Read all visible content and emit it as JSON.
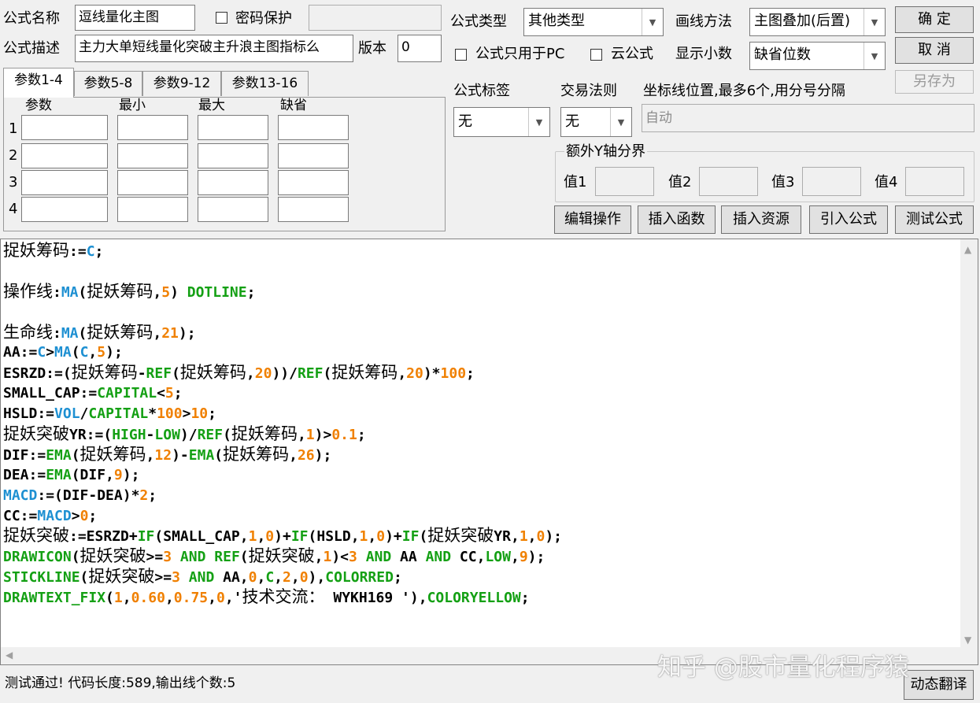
{
  "formula": {
    "name_label": "公式名称",
    "name_value": "逗线量化主图",
    "password_label": "密码保护",
    "desc_label": "公式描述",
    "desc_value": "主力大单短线量化突破主升浪主图指标么",
    "version_label": "版本",
    "version_value": "0",
    "type_label": "公式类型",
    "type_value": "其他类型",
    "draw_label": "画线方法",
    "draw_value": "主图叠加(后置)",
    "pc_only_label": "公式只用于PC",
    "cloud_label": "云公式",
    "decimal_label": "显示小数",
    "decimal_value": "缺省位数",
    "tag_label": "公式标签",
    "tag_value": "无",
    "rule_label": "交易法则",
    "rule_value": "无",
    "coord_label": "坐标线位置,最多6个,用分号分隔",
    "coord_placeholder": "自动",
    "yaxis_label": "额外Y轴分界",
    "y_values": [
      "值1",
      "值2",
      "值3",
      "值4"
    ]
  },
  "buttons": {
    "ok": "确  定",
    "cancel": "取  消",
    "save_as": "另存为",
    "edit": "编辑操作",
    "insert_func": "插入函数",
    "insert_res": "插入资源",
    "import": "引入公式",
    "test": "测试公式",
    "translate": "动态翻译"
  },
  "param_tabs": [
    "参数1-4",
    "参数5-8",
    "参数9-12",
    "参数13-16"
  ],
  "param_headers": [
    "参数",
    "最小",
    "最大",
    "缺省"
  ],
  "param_rows": [
    "1",
    "2",
    "3",
    "4"
  ],
  "code_lines": [
    [
      [
        "t",
        "捉妖筹码"
      ],
      [
        "p",
        ":="
      ],
      [
        "b",
        "C"
      ],
      [
        "p",
        ";"
      ]
    ],
    [],
    [
      [
        "t",
        "操作线"
      ],
      [
        "p",
        ":"
      ],
      [
        "b",
        "MA"
      ],
      [
        "p",
        "("
      ],
      [
        "t",
        "捉妖筹码"
      ],
      [
        "p",
        ","
      ],
      [
        "n",
        "5"
      ],
      [
        "p",
        ") "
      ],
      [
        "g",
        "DOTLINE"
      ],
      [
        "p",
        ";"
      ]
    ],
    [],
    [
      [
        "t",
        "生命线"
      ],
      [
        "p",
        ":"
      ],
      [
        "b",
        "MA"
      ],
      [
        "p",
        "("
      ],
      [
        "t",
        "捉妖筹码"
      ],
      [
        "p",
        ","
      ],
      [
        "n",
        "21"
      ],
      [
        "p",
        ");"
      ]
    ],
    [
      [
        "p",
        "AA:="
      ],
      [
        "b",
        "C"
      ],
      [
        "p",
        ">"
      ],
      [
        "b",
        "MA"
      ],
      [
        "p",
        "("
      ],
      [
        "b",
        "C"
      ],
      [
        "p",
        ","
      ],
      [
        "n",
        "5"
      ],
      [
        "p",
        ");"
      ]
    ],
    [
      [
        "p",
        "ESRZD:=("
      ],
      [
        "t",
        "捉妖筹码"
      ],
      [
        "p",
        "-"
      ],
      [
        "g",
        "REF"
      ],
      [
        "p",
        "("
      ],
      [
        "t",
        "捉妖筹码"
      ],
      [
        "p",
        ","
      ],
      [
        "n",
        "20"
      ],
      [
        "p",
        "))/"
      ],
      [
        "g",
        "REF"
      ],
      [
        "p",
        "("
      ],
      [
        "t",
        "捉妖筹码"
      ],
      [
        "p",
        ","
      ],
      [
        "n",
        "20"
      ],
      [
        "p",
        ")*"
      ],
      [
        "n",
        "100"
      ],
      [
        "p",
        ";"
      ]
    ],
    [
      [
        "p",
        "SMALL_CAP:="
      ],
      [
        "g",
        "CAPITAL"
      ],
      [
        "p",
        "<"
      ],
      [
        "n",
        "5"
      ],
      [
        "p",
        ";"
      ]
    ],
    [
      [
        "p",
        "HSLD:="
      ],
      [
        "b",
        "VOL"
      ],
      [
        "p",
        "/"
      ],
      [
        "g",
        "CAPITAL"
      ],
      [
        "p",
        "*"
      ],
      [
        "n",
        "100"
      ],
      [
        "p",
        ">"
      ],
      [
        "n",
        "10"
      ],
      [
        "p",
        ";"
      ]
    ],
    [
      [
        "t",
        "捉妖突破"
      ],
      [
        "p",
        "YR:=("
      ],
      [
        "g",
        "HIGH"
      ],
      [
        "p",
        "-"
      ],
      [
        "g",
        "LOW"
      ],
      [
        "p",
        ")/"
      ],
      [
        "g",
        "REF"
      ],
      [
        "p",
        "("
      ],
      [
        "t",
        "捉妖筹码"
      ],
      [
        "p",
        ","
      ],
      [
        "n",
        "1"
      ],
      [
        "p",
        ")>"
      ],
      [
        "n",
        "0.1"
      ],
      [
        "p",
        ";"
      ]
    ],
    [
      [
        "p",
        "DIF:="
      ],
      [
        "g",
        "EMA"
      ],
      [
        "p",
        "("
      ],
      [
        "t",
        "捉妖筹码"
      ],
      [
        "p",
        ","
      ],
      [
        "n",
        "12"
      ],
      [
        "p",
        ")-"
      ],
      [
        "g",
        "EMA"
      ],
      [
        "p",
        "("
      ],
      [
        "t",
        "捉妖筹码"
      ],
      [
        "p",
        ","
      ],
      [
        "n",
        "26"
      ],
      [
        "p",
        ");"
      ]
    ],
    [
      [
        "p",
        "DEA:="
      ],
      [
        "g",
        "EMA"
      ],
      [
        "p",
        "(DIF,"
      ],
      [
        "n",
        "9"
      ],
      [
        "p",
        ");"
      ]
    ],
    [
      [
        "b",
        "MACD"
      ],
      [
        "p",
        ":=(DIF-DEA)*"
      ],
      [
        "n",
        "2"
      ],
      [
        "p",
        ";"
      ]
    ],
    [
      [
        "p",
        "CC:="
      ],
      [
        "b",
        "MACD"
      ],
      [
        "p",
        ">"
      ],
      [
        "n",
        "0"
      ],
      [
        "p",
        ";"
      ]
    ],
    [
      [
        "t",
        "捉妖突破"
      ],
      [
        "p",
        ":=ESRZD+"
      ],
      [
        "g",
        "IF"
      ],
      [
        "p",
        "(SMALL_CAP,"
      ],
      [
        "n",
        "1"
      ],
      [
        "p",
        ","
      ],
      [
        "n",
        "0"
      ],
      [
        "p",
        ")+"
      ],
      [
        "g",
        "IF"
      ],
      [
        "p",
        "(HSLD,"
      ],
      [
        "n",
        "1"
      ],
      [
        "p",
        ","
      ],
      [
        "n",
        "0"
      ],
      [
        "p",
        ")+"
      ],
      [
        "g",
        "IF"
      ],
      [
        "p",
        "("
      ],
      [
        "t",
        "捉妖突破"
      ],
      [
        "p",
        "YR,"
      ],
      [
        "n",
        "1"
      ],
      [
        "p",
        ","
      ],
      [
        "n",
        "0"
      ],
      [
        "p",
        ");"
      ]
    ],
    [
      [
        "g",
        "DRAWICON"
      ],
      [
        "p",
        "("
      ],
      [
        "t",
        "捉妖突破"
      ],
      [
        "p",
        ">="
      ],
      [
        "n",
        "3"
      ],
      [
        "p",
        " "
      ],
      [
        "g",
        "AND"
      ],
      [
        "p",
        " "
      ],
      [
        "g",
        "REF"
      ],
      [
        "p",
        "("
      ],
      [
        "t",
        "捉妖突破"
      ],
      [
        "p",
        ","
      ],
      [
        "n",
        "1"
      ],
      [
        "p",
        ")<"
      ],
      [
        "n",
        "3"
      ],
      [
        "p",
        " "
      ],
      [
        "g",
        "AND"
      ],
      [
        "p",
        " AA "
      ],
      [
        "g",
        "AND"
      ],
      [
        "p",
        " CC,"
      ],
      [
        "g",
        "LOW"
      ],
      [
        "p",
        ","
      ],
      [
        "n",
        "9"
      ],
      [
        "p",
        ");"
      ]
    ],
    [
      [
        "g",
        "STICKLINE"
      ],
      [
        "p",
        "("
      ],
      [
        "t",
        "捉妖突破"
      ],
      [
        "p",
        ">="
      ],
      [
        "n",
        "3"
      ],
      [
        "p",
        " "
      ],
      [
        "g",
        "AND"
      ],
      [
        "p",
        " AA,"
      ],
      [
        "n",
        "0"
      ],
      [
        "p",
        ","
      ],
      [
        "g",
        "C"
      ],
      [
        "p",
        ","
      ],
      [
        "n",
        "2"
      ],
      [
        "p",
        ","
      ],
      [
        "n",
        "0"
      ],
      [
        "p",
        "),"
      ],
      [
        "g",
        "COLORRED"
      ],
      [
        "p",
        ";"
      ]
    ],
    [
      [
        "g",
        "DRAWTEXT_FIX"
      ],
      [
        "p",
        "("
      ],
      [
        "n",
        "1"
      ],
      [
        "p",
        ","
      ],
      [
        "n",
        "0.60"
      ],
      [
        "p",
        ","
      ],
      [
        "n",
        "0.75"
      ],
      [
        "p",
        ","
      ],
      [
        "n",
        "0"
      ],
      [
        "p",
        ",'"
      ],
      [
        "t",
        "技术交流："
      ],
      [
        "p",
        " WYKH169 '),"
      ],
      [
        "g",
        "COLORYELLOW"
      ],
      [
        "p",
        ";"
      ]
    ]
  ],
  "status_text": "测试通过! 代码长度:589,输出线个数:5",
  "watermark": "知乎 @股市量化程序猿"
}
